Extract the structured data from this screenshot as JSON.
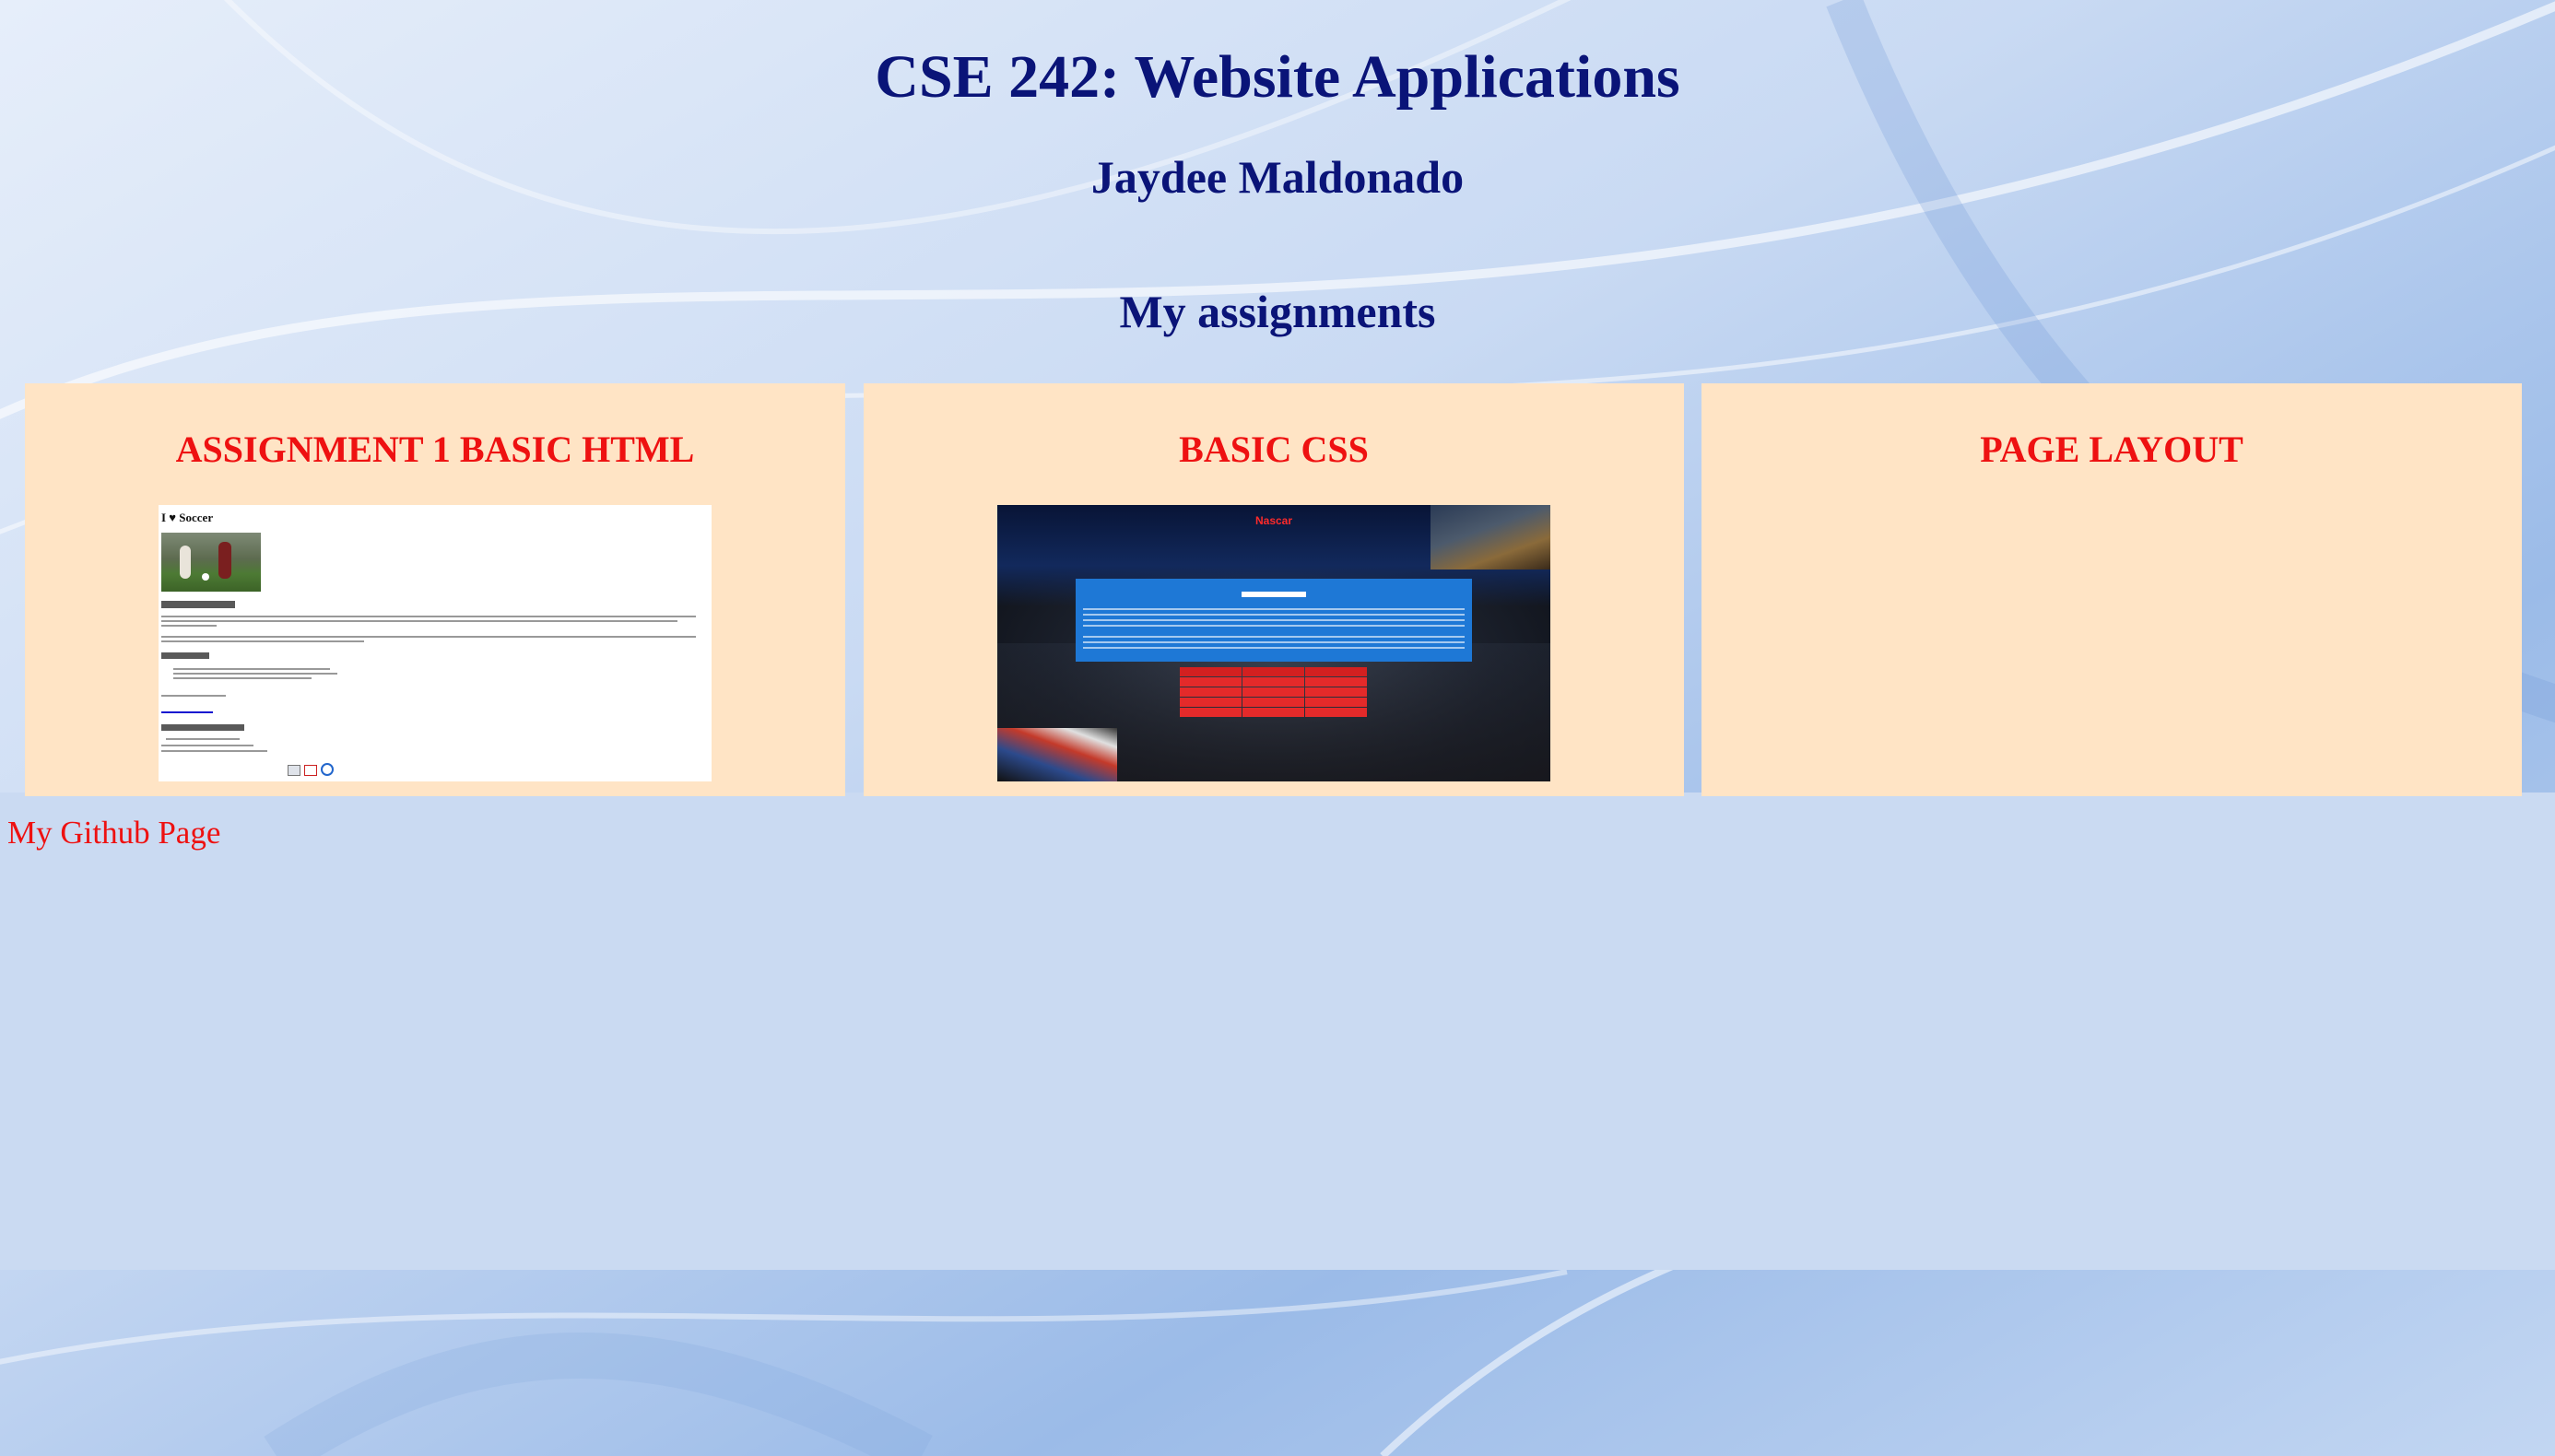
{
  "header": {
    "title": "CSE 242: Website Applications",
    "author": "Jaydee Maldonado",
    "section": "My assignments"
  },
  "assignments": [
    {
      "title": "ASSIGNMENT 1 BASIC HTML",
      "thumbnail": {
        "heading": "I ♥ Soccer"
      }
    },
    {
      "title": "BASIC CSS",
      "thumbnail": {
        "heading": "Nascar"
      }
    },
    {
      "title": "PAGE LAYOUT"
    }
  ],
  "footer": {
    "github_link": "My Github Page"
  },
  "colors": {
    "heading": "#0a1478",
    "card_title": "#ee1111",
    "card_background": "#ffe4c5",
    "link": "#ee1111"
  }
}
